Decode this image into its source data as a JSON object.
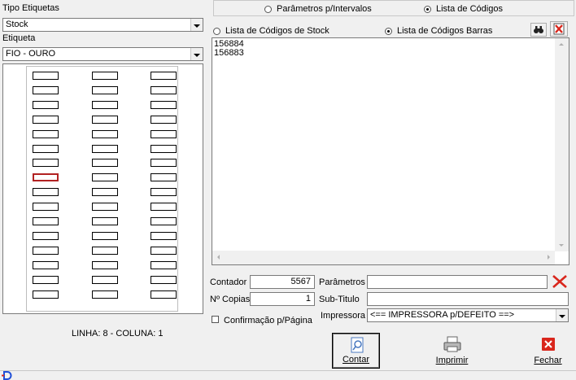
{
  "left": {
    "tipo_label": "Tipo Etiquetas",
    "tipo_value": "Stock",
    "etiqueta_label": "Etiqueta",
    "etiqueta_value": "FIO - OURO",
    "position_label": "LINHA:  8  -  COLUNA:  1",
    "grid_rows": 16,
    "grid_cols": 3,
    "selected_row": 8,
    "selected_col": 1
  },
  "top_options": {
    "intervalos": "Parâmetros p/Intervalos",
    "lista_codigos": "Lista de Códigos",
    "selected": "lista_codigos"
  },
  "list_options": {
    "stock": "Lista de Códigos de Stock",
    "barras": "Lista de Códigos Barras",
    "selected": "barras"
  },
  "codes_text": "156884\n156883",
  "fields": {
    "contador_label": "Contador",
    "contador_value": "5567",
    "copias_label": "Nº Copias",
    "copias_value": "1",
    "parametros_label": "Parâmetros",
    "parametros_value": "",
    "subtitulo_label": "Sub-Titulo",
    "subtitulo_value": "",
    "impressora_label": "Impressora",
    "impressora_value": "<== IMPRESSORA  p/DEFEITO  ==>",
    "confirmacao_label": "Confirmação p/Página"
  },
  "buttons": {
    "contar": "Contar",
    "imprimir": "Imprimir",
    "fechar": "Fechar"
  },
  "colors": {
    "selected_cell": "#b22222",
    "clear_red": "#d9261c",
    "status_icon": "#1f4fd8"
  }
}
